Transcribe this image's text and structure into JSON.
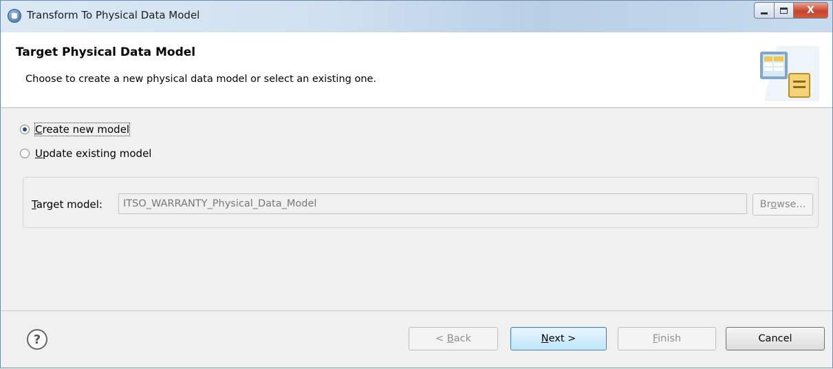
{
  "window": {
    "title": "Transform To Physical Data Model",
    "close_glyph": "X"
  },
  "banner": {
    "heading": "Target Physical Data Model",
    "description": "Choose to create a new physical data model or select an existing one.",
    "icon": "wizard-table-icon"
  },
  "options": {
    "create_new": {
      "mnemonic": "C",
      "rest": "reate new model",
      "selected": true
    },
    "update_existing": {
      "mnemonic": "U",
      "rest": "pdate existing model",
      "selected": false
    }
  },
  "target": {
    "label_mnemonic": "T",
    "label_rest": "arget model:",
    "value": "ITSO_WARRANTY_Physical_Data_Model",
    "browse_pre": "Br",
    "browse_mnemonic": "o",
    "browse_post": "wse..."
  },
  "footer": {
    "help_glyph": "?",
    "back_pre": "< ",
    "back_mnemonic": "B",
    "back_post": "ack",
    "next_mnemonic": "N",
    "next_post": "ext >",
    "finish_mnemonic": "F",
    "finish_post": "inish",
    "cancel_label": "Cancel"
  },
  "colors": {
    "primary_button": "#bee6fd",
    "title_bar": "#cfe0f0",
    "close_button": "#c7432a"
  }
}
